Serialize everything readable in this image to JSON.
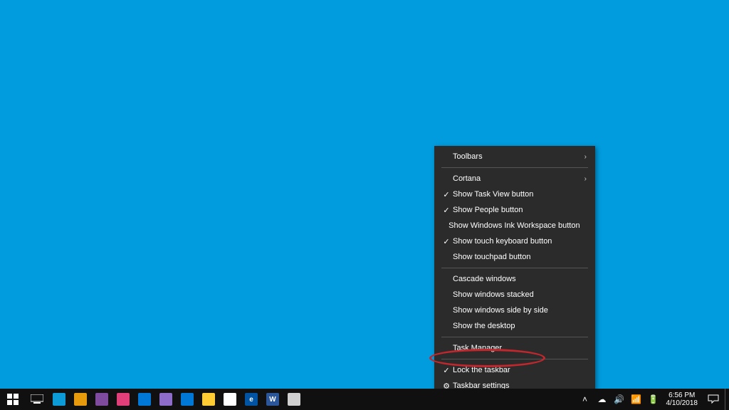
{
  "context_menu": {
    "groups": [
      [
        {
          "label": "Toolbars",
          "submenu": true
        }
      ],
      [
        {
          "label": "Cortana",
          "submenu": true
        },
        {
          "label": "Show Task View button",
          "checked": true
        },
        {
          "label": "Show People button",
          "checked": true
        },
        {
          "label": "Show Windows Ink Workspace button"
        },
        {
          "label": "Show touch keyboard button",
          "checked": true
        },
        {
          "label": "Show touchpad button"
        }
      ],
      [
        {
          "label": "Cascade windows"
        },
        {
          "label": "Show windows stacked"
        },
        {
          "label": "Show windows side by side"
        },
        {
          "label": "Show the desktop"
        }
      ],
      [
        {
          "label": "Task Manager",
          "annotated": true
        }
      ],
      [
        {
          "label": "Lock the taskbar",
          "checked": true
        },
        {
          "label": "Taskbar settings",
          "icon": "gear"
        }
      ]
    ]
  },
  "taskbar": {
    "pinned": [
      {
        "name": "app-generic-1",
        "bg": "#0d9bd8",
        "glyph": ""
      },
      {
        "name": "app-generic-2",
        "bg": "#e89a0d",
        "glyph": ""
      },
      {
        "name": "app-paint",
        "bg": "#7e4b9e",
        "glyph": ""
      },
      {
        "name": "app-maps",
        "bg": "#e03f7a",
        "glyph": ""
      },
      {
        "name": "app-generic-3",
        "bg": "#0078d7",
        "glyph": ""
      },
      {
        "name": "app-notes",
        "bg": "#8e6cc9",
        "glyph": ""
      },
      {
        "name": "app-store",
        "bg": "#0078d7",
        "glyph": ""
      },
      {
        "name": "file-explorer",
        "bg": "#ffcc33",
        "glyph": ""
      },
      {
        "name": "chrome",
        "bg": "#ffffff",
        "glyph": ""
      },
      {
        "name": "edge",
        "bg": "#0154a4",
        "glyph": "e"
      },
      {
        "name": "word",
        "bg": "#2b579a",
        "glyph": "W"
      },
      {
        "name": "app-generic-4",
        "bg": "#d0d0d0",
        "glyph": ""
      },
      {
        "name": "dropbox",
        "bg": "#101010",
        "glyph": ""
      }
    ],
    "tray": [
      {
        "name": "tray-chevron-icon",
        "glyph": "˄"
      },
      {
        "name": "tray-onedrive-icon",
        "glyph": "☁"
      },
      {
        "name": "tray-volume-icon",
        "glyph": "🔊"
      },
      {
        "name": "tray-network-icon",
        "glyph": "📶"
      },
      {
        "name": "tray-battery-icon",
        "glyph": "🔋"
      }
    ],
    "clock": {
      "time": "6:56 PM",
      "date": "4/10/2018"
    }
  }
}
